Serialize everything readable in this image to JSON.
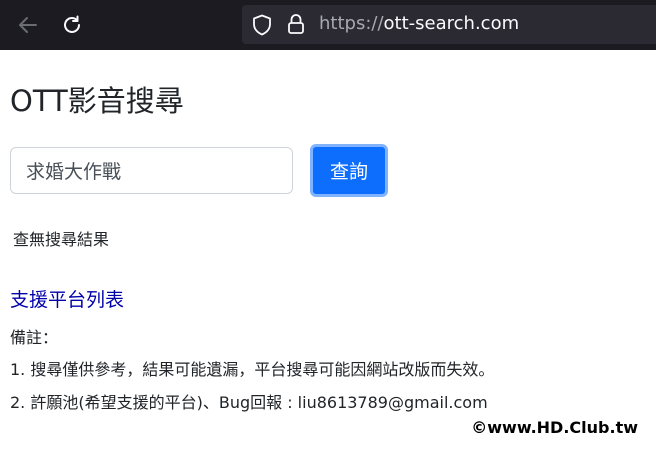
{
  "browser": {
    "url_scheme": "https://",
    "url_host": "ott-search.com",
    "icons": [
      "back-arrow-icon",
      "reload-icon",
      "shield-icon",
      "lock-icon"
    ],
    "colors": {
      "chrome_bg": "#1c1b22",
      "urlbar_bg": "#2b2a33"
    }
  },
  "page": {
    "title": "OTT影音搜尋",
    "search": {
      "value": "求婚大作戰",
      "button_label": "查詢"
    },
    "result_message": "查無搜尋結果",
    "platform_link": "支援平台列表",
    "notes": {
      "heading": "備註：",
      "items": [
        "1. 搜尋僅供參考，結果可能遺漏，平台搜尋可能因網站改版而失效。",
        "2. 許願池(希望支援的平台)、Bug回報 : liu8613789@gmail.com"
      ]
    },
    "colors": {
      "primary": "#0d6efd",
      "link": "#0000a8"
    }
  },
  "watermark": "©www.HD.Club.tw"
}
